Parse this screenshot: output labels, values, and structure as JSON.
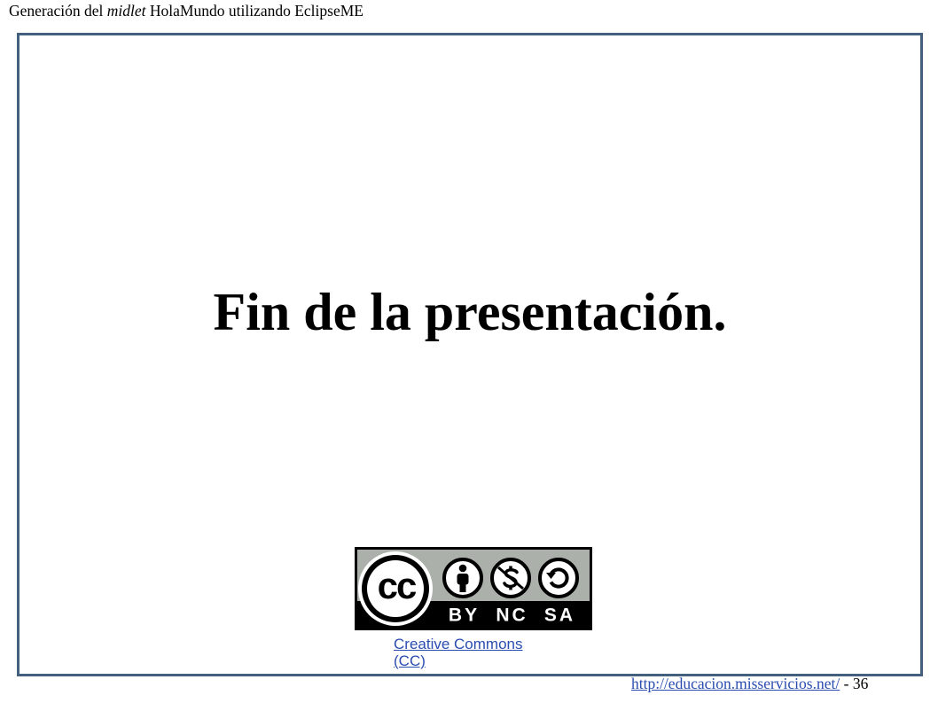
{
  "header": {
    "before": "Generación del ",
    "italic": "midlet",
    "after": " HolaMundo utilizando EclipseME"
  },
  "slide": {
    "title": "Fin de la presentación."
  },
  "license_badge": {
    "cc_label": "cc",
    "labels": [
      "BY",
      "NC",
      "SA"
    ],
    "icons": [
      "cc-icon",
      "by-person-icon",
      "nc-dollar-icon",
      "sa-share-alike-icon"
    ]
  },
  "license_link": {
    "text": "Creative Commons (CC)"
  },
  "footer": {
    "url": "http://educacion.misservicios.net/",
    "separator": " - ",
    "page_number": "36"
  },
  "colors": {
    "frame": "#43607e",
    "link": "#2a4db0",
    "badge_grey": "#abb1aa",
    "text": "#000000"
  }
}
